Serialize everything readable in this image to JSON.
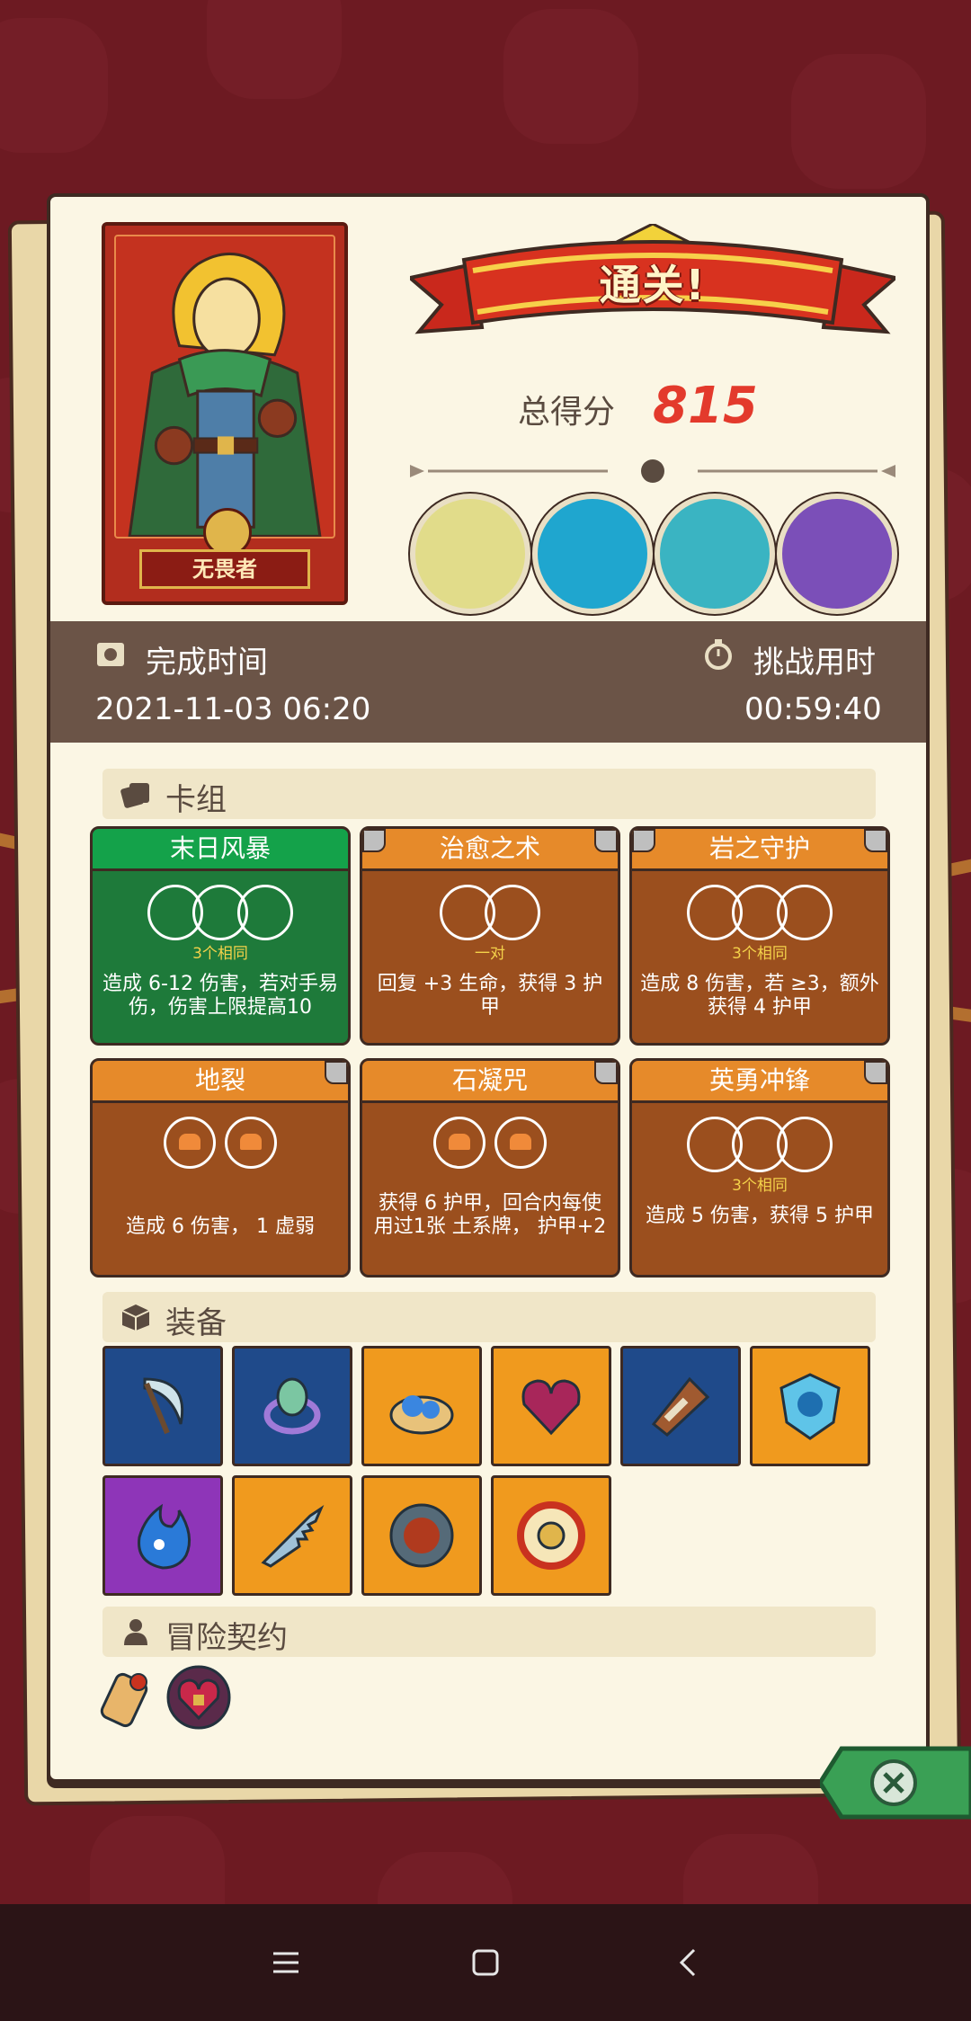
{
  "hero": {
    "name": "无畏者",
    "image": "hero-portrait"
  },
  "result": {
    "title": "通关!",
    "score_label": "总得分",
    "score": "815"
  },
  "bosses": [
    "skeleton-dragon-boss-icon",
    "shadow-horse-boss-icon",
    "fish-dragon-boss-icon",
    "purple-dragon-boss-icon"
  ],
  "times": {
    "finish_label": "完成时间",
    "finish_value": "2021-11-03 06:20",
    "challenge_label": "挑战用时",
    "challenge_value": "00:59:40"
  },
  "deck": {
    "title": "卡组",
    "cards": [
      {
        "name": "末日风暴",
        "slot_label": "3个相同",
        "desc": "造成 6-12 伤害，若对手易伤，伤害上限提高10",
        "theme": "green"
      },
      {
        "name": "治愈之术",
        "slot_label": "一对",
        "desc": "回复 +3 生命，获得 3 护甲",
        "theme": "orange"
      },
      {
        "name": "岩之守护",
        "slot_label": "3个相同",
        "desc": "造成 8 伤害，若 ≥3，额外获得 4 护甲",
        "theme": "orange"
      },
      {
        "name": "地裂",
        "slot_label": "",
        "desc": "造成 6 伤害， 1 虚弱",
        "theme": "orange"
      },
      {
        "name": "石凝咒",
        "slot_label": "",
        "desc": "获得 6 护甲，回合内每使用过1张 土系牌， 护甲+2",
        "theme": "orange"
      },
      {
        "name": "英勇冲锋",
        "slot_label": "3个相同",
        "desc": "造成 5 伤害，获得 5 护甲",
        "theme": "orange"
      }
    ]
  },
  "equipment": {
    "title": "装备",
    "items": [
      {
        "icon": "scythe-icon",
        "color": "#1f4a8a"
      },
      {
        "icon": "eye-ring-icon",
        "color": "#1f4a8a"
      },
      {
        "icon": "blue-gems-icon",
        "color": "#f09a1e"
      },
      {
        "icon": "cursed-heart-icon",
        "color": "#f09a1e"
      },
      {
        "icon": "horn-icon",
        "color": "#1f4a8a"
      },
      {
        "icon": "ice-shield-icon",
        "color": "#f09a1e"
      },
      {
        "icon": "blue-flame-icon",
        "color": "#8e35b8"
      },
      {
        "icon": "saw-blade-icon",
        "color": "#f09a1e"
      },
      {
        "icon": "meteor-medal-icon",
        "color": "#f09a1e"
      },
      {
        "icon": "gold-amulet-icon",
        "color": "#f09a1e"
      }
    ]
  },
  "contracts": {
    "title": "冒险契约",
    "items": [
      "scroll-icon",
      "locked-heart-icon"
    ]
  },
  "colors": {
    "accent_red": "#e33a2c",
    "panel": "#fbf6e4",
    "time_bar": "#6b5447"
  }
}
